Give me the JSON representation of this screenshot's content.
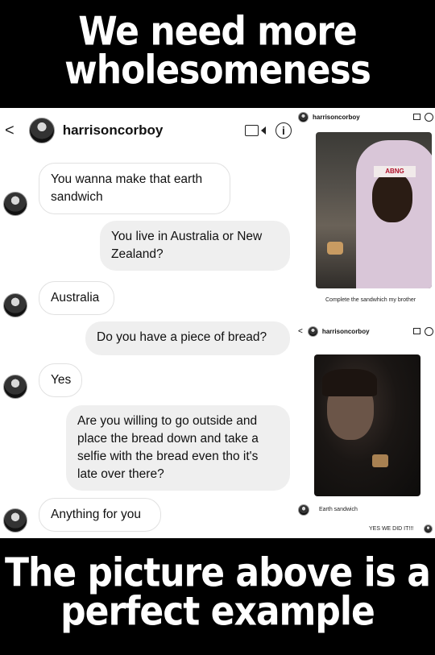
{
  "captions": {
    "top_line1": "We need more",
    "top_line2": "wholesomeness",
    "bottom_line1": "The picture above is a",
    "bottom_line2": "perfect example"
  },
  "left_chat": {
    "username": "harrisoncorboy",
    "back_glyph": "<",
    "info_glyph": "i",
    "messages": [
      {
        "from": "them",
        "text": "You wanna make that earth sandwich"
      },
      {
        "from": "me",
        "text": "You live in Australia or New Zealand?"
      },
      {
        "from": "them",
        "text": "Australia"
      },
      {
        "from": "me",
        "text": "Do you have a piece of bread?"
      },
      {
        "from": "them",
        "text": "Yes"
      },
      {
        "from": "me",
        "text": "Are you willing to go outside and place the bread down and take a selfie with the bread even tho it's late over there?"
      },
      {
        "from": "them",
        "text": "Anything for you"
      }
    ]
  },
  "right_chat_top": {
    "username": "harrisoncorboy",
    "photo_cap_text": "ABNG",
    "reply": "Complete the sandwhich my brother"
  },
  "right_chat_bottom": {
    "username": "harrisoncorboy",
    "back_glyph": "<",
    "reply": "Earth sandwich",
    "my_reply": "YES WE DID IT!!!"
  },
  "colors": {
    "background": "#000000",
    "caption_text": "#ffffff",
    "sent_bubble": "#efefef",
    "received_bubble_border": "#e1e1e1"
  }
}
